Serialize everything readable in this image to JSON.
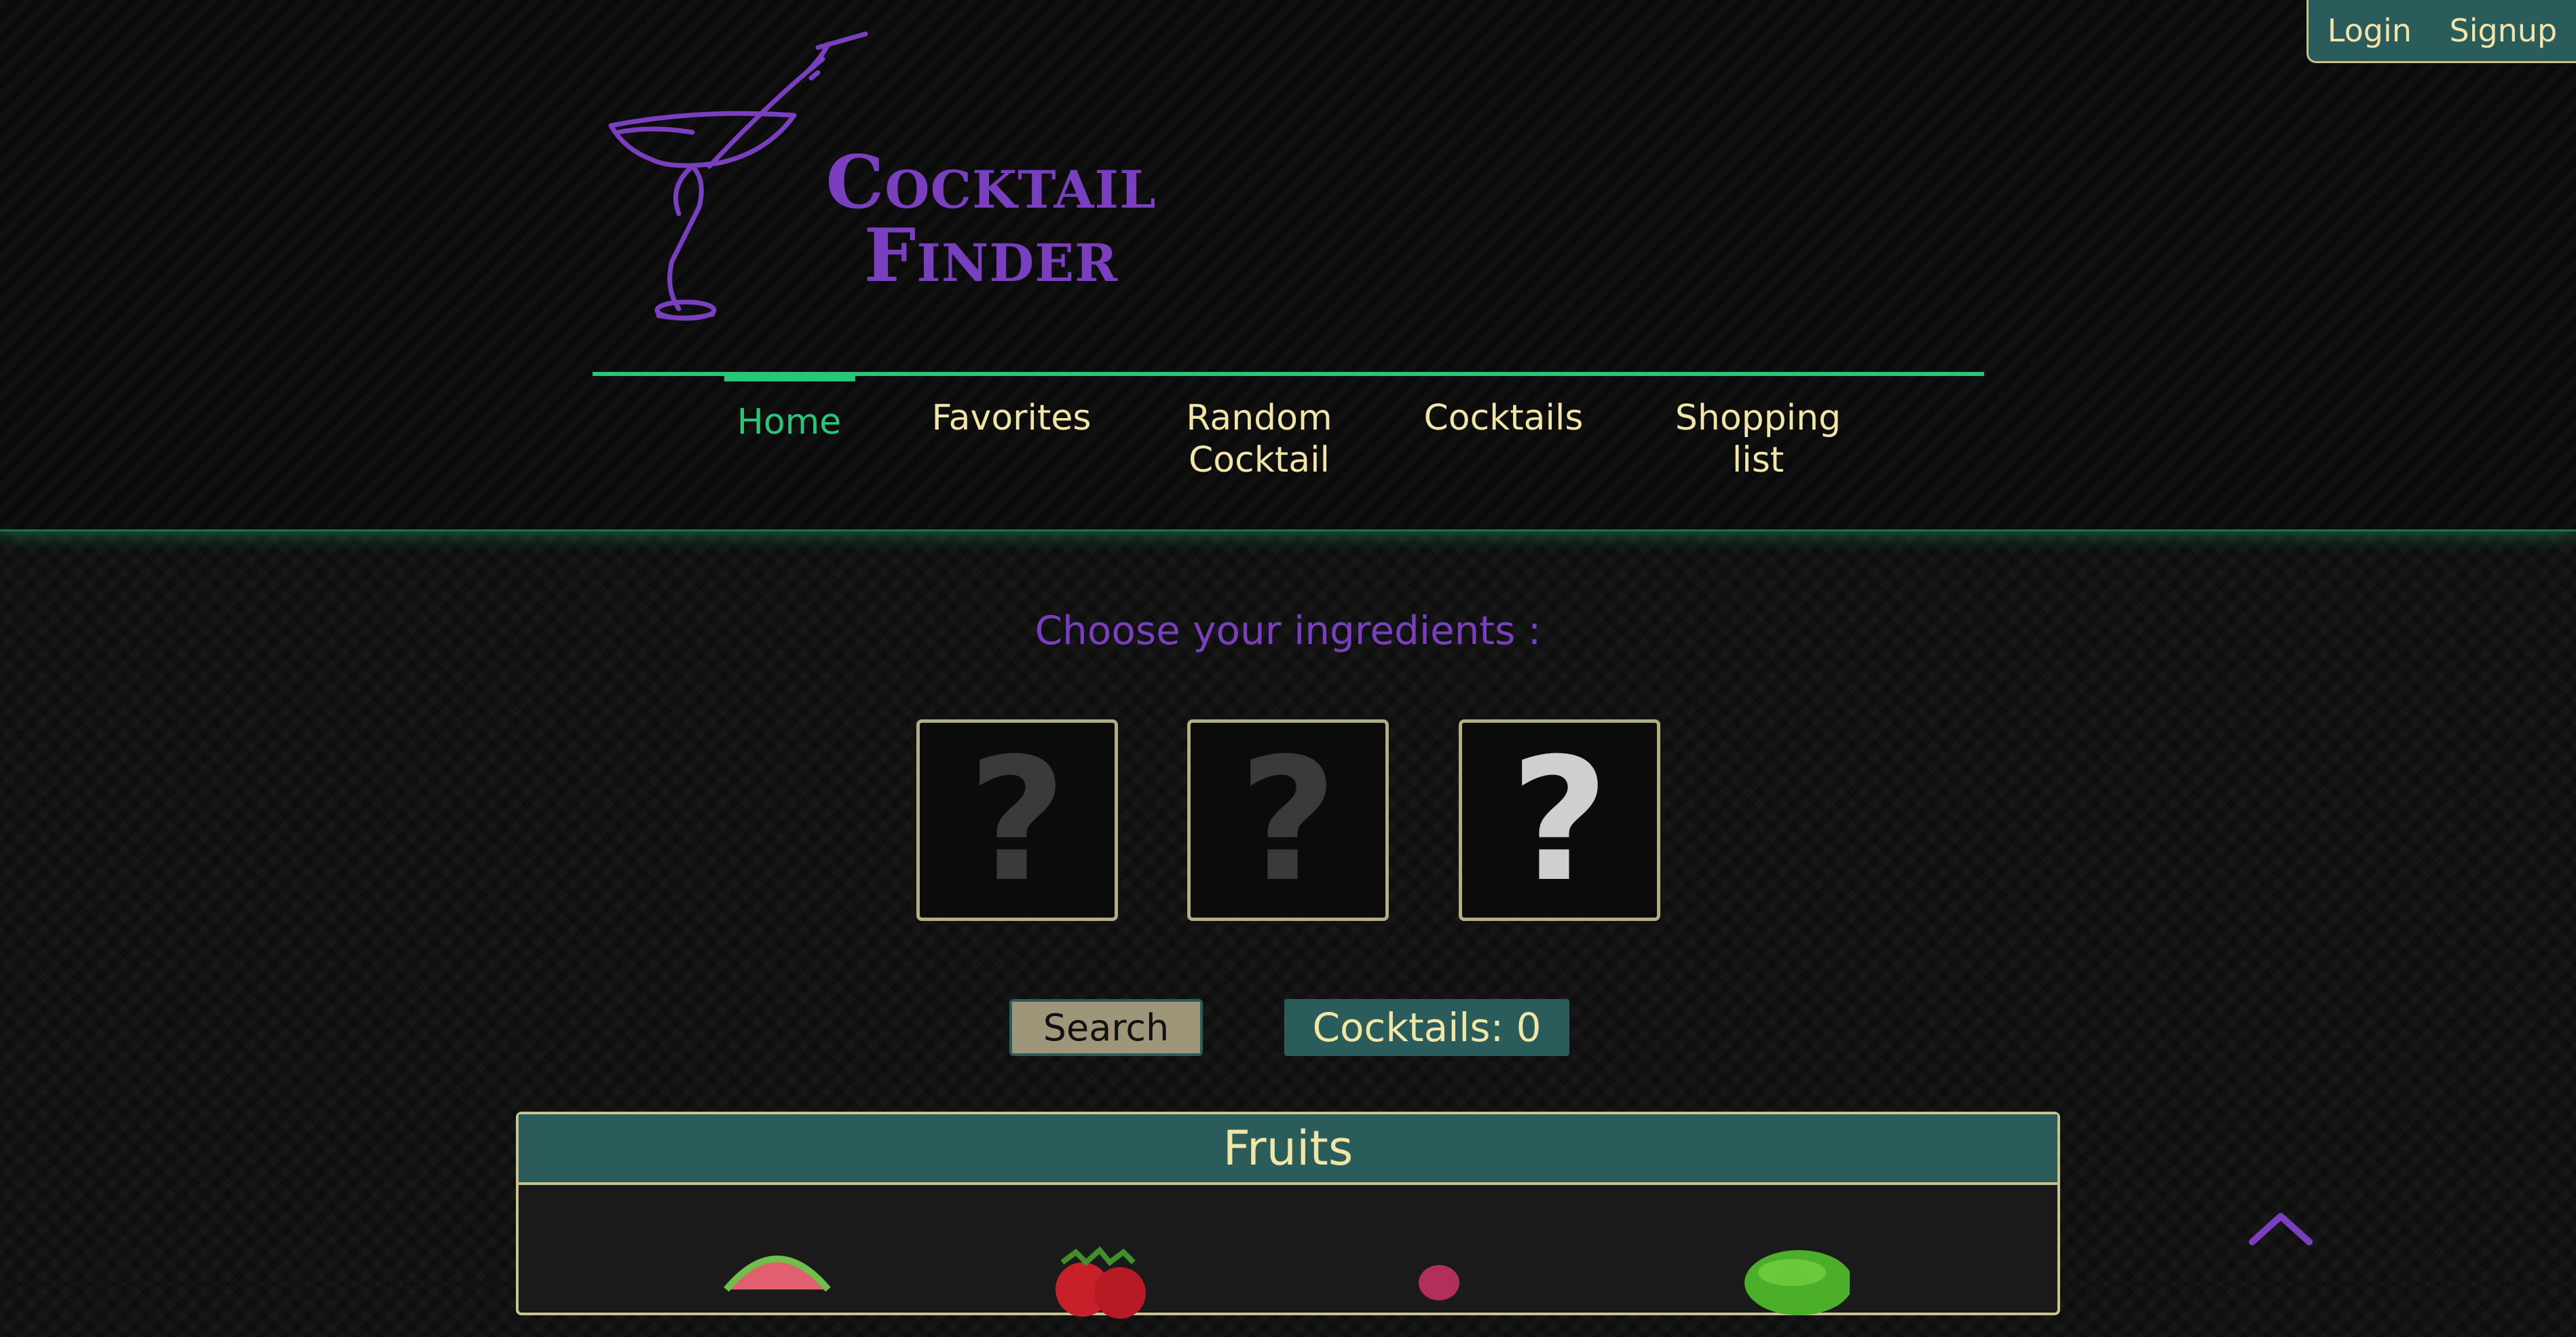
{
  "auth": {
    "login_label": "Login",
    "signup_label": "Signup"
  },
  "brand": {
    "line1": "Cocktail",
    "line2": "Finder",
    "logo_icon": "cocktail-glass-icon"
  },
  "nav": {
    "items": [
      {
        "label_line1": "Home",
        "label_line2": "",
        "active": true
      },
      {
        "label_line1": "Favorites",
        "label_line2": ""
      },
      {
        "label_line1": "Random",
        "label_line2": "Cocktail"
      },
      {
        "label_line1": "Cocktails",
        "label_line2": ""
      },
      {
        "label_line1": "Shopping",
        "label_line2": "list"
      }
    ]
  },
  "main": {
    "prompt": "Choose your ingredients :",
    "slots": [
      {
        "glyph": "?",
        "icon": "question-mark-icon"
      },
      {
        "glyph": "?",
        "icon": "question-mark-icon"
      },
      {
        "glyph": "?",
        "icon": "question-mark-icon"
      }
    ],
    "search_label": "Search",
    "count_label": "Cocktails: 0"
  },
  "category": {
    "title": "Fruits",
    "items": [
      {
        "icon": "watermelon-icon"
      },
      {
        "icon": "strawberry-icon"
      },
      {
        "icon": "raspberry-icon"
      },
      {
        "icon": "lime-icon"
      }
    ]
  },
  "colors": {
    "accent_green": "#26c878",
    "brand_purple": "#7a3fbf",
    "panel_teal": "#2a5c5c",
    "text_cream": "#f2e6a6",
    "border_khaki": "#c9c28a"
  },
  "scroll_top_icon": "chevron-up-icon"
}
